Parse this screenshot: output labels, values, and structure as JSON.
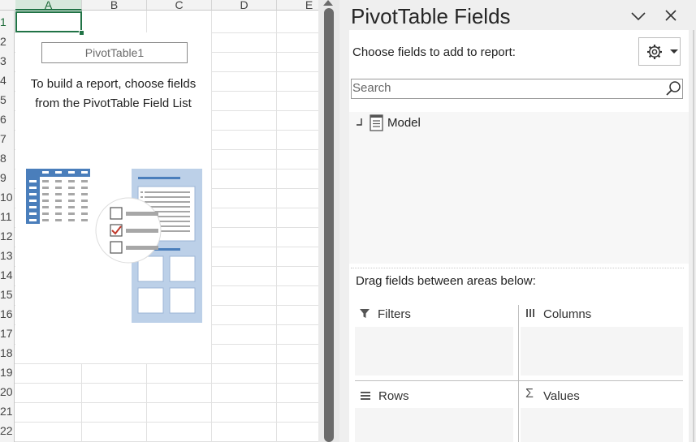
{
  "sheet": {
    "columns": [
      "A",
      "B",
      "C",
      "D",
      "E"
    ],
    "rows": [
      "1",
      "2",
      "3",
      "4",
      "5",
      "6",
      "7",
      "8",
      "9",
      "10",
      "11",
      "12",
      "13",
      "14",
      "15",
      "16",
      "17",
      "18",
      "19",
      "20",
      "21",
      "22"
    ],
    "pivot_name": "PivotTable1",
    "instruction_line1": "To build a report, choose fields",
    "instruction_line2": "from the PivotTable Field List"
  },
  "pane": {
    "title": "PivotTable Fields",
    "choose_label": "Choose fields to add to report:",
    "search_placeholder": "Search",
    "fields": [
      {
        "label": "Model",
        "icon": "table-icon"
      }
    ],
    "drag_label": "Drag fields between areas below:",
    "areas": {
      "filters": "Filters",
      "columns": "Columns",
      "rows": "Rows",
      "values": "Values"
    }
  },
  "colors": {
    "accent": "#217346",
    "illustration_blue": "#4a7ebb",
    "illustration_light": "#bcd0e8",
    "check_red": "#c0392b"
  }
}
